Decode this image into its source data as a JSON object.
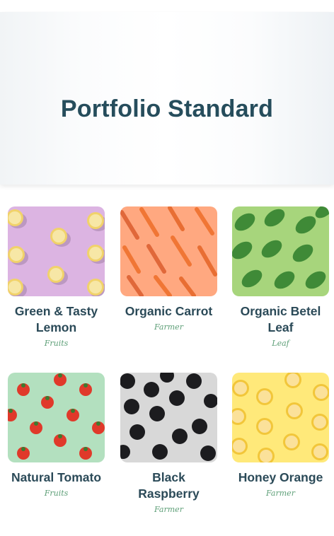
{
  "hero": {
    "title": "Portfolio Standard"
  },
  "items": [
    {
      "title": "Green & Tasty Lemon",
      "category": "Fruits",
      "bg": "#dcb4e2"
    },
    {
      "title": "Organic Carrot",
      "category": "Farmer",
      "bg": "#ffa880"
    },
    {
      "title": "Organic Betel Leaf",
      "category": "Leaf",
      "bg": "#a7d57c"
    },
    {
      "title": "Natural Tomato",
      "category": "Fruits",
      "bg": "#b3e0bf"
    },
    {
      "title": "Black Raspberry",
      "category": "Farmer",
      "bg": "#d8d8d8"
    },
    {
      "title": "Honey Orange",
      "category": "Farmer",
      "bg": "#ffe97a"
    }
  ]
}
